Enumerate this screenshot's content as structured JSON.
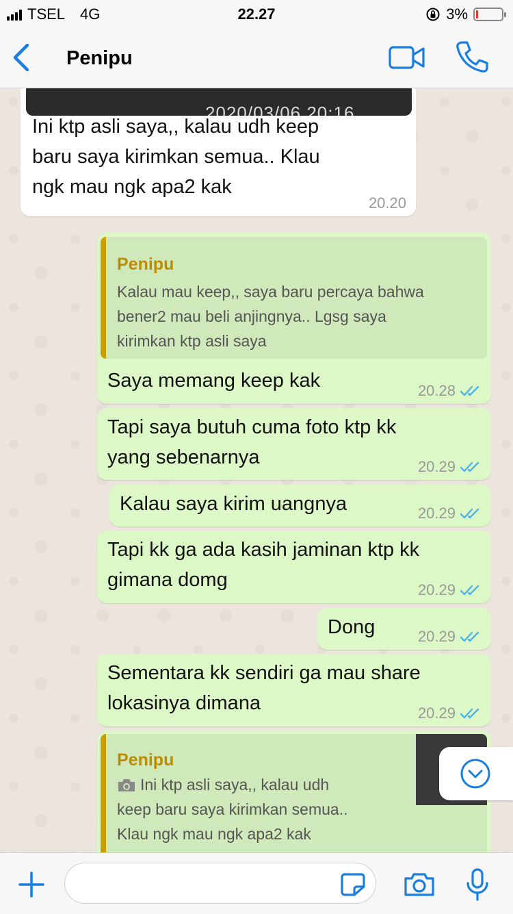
{
  "status": {
    "carrier": "TSEL",
    "network": "4G",
    "time": "22.27",
    "battery": "3%"
  },
  "header": {
    "contact": "Penipu"
  },
  "messages": [
    {
      "dir": "in",
      "image_stamp": "2020/03/06 20:16",
      "text": "Ini ktp asli saya,,  kalau udh keep\nbaru saya kirimkan semua..  Klau\nngk mau ngk apa2 kak",
      "time": "20.20"
    },
    {
      "dir": "out",
      "quote": {
        "name": "Penipu",
        "text": "Kalau mau keep,,  saya baru percaya bahwa\nbener2 mau beli anjingnya..  Lgsg saya\nkirimkan ktp asli saya"
      },
      "text": "Saya memang keep kak",
      "time": "20.28"
    },
    {
      "dir": "out",
      "text": "Tapi saya butuh cuma foto ktp kk\nyang sebenarnya",
      "time": "20.29"
    },
    {
      "dir": "out",
      "text": "Kalau saya kirim uangnya",
      "time": "20.29"
    },
    {
      "dir": "out",
      "text": "Tapi kk ga ada kasih jaminan ktp kk\ngimana domg",
      "time": "20.29"
    },
    {
      "dir": "out",
      "text": "Dong",
      "time": "20.29"
    },
    {
      "dir": "out",
      "text": "Sementara kk sendiri ga mau share\nlokasinya dimana",
      "time": "20.29"
    },
    {
      "dir": "out",
      "quote": {
        "name": "Penipu",
        "text": "Ini ktp asli saya,,  kalau udh\nkeep baru saya kirimkan semua..\nKlau ngk mau ngk apa2 kak"
      }
    }
  ],
  "colors": {
    "outgoing": "#dcf8c6",
    "incoming": "#ffffff",
    "accent": "#1a7ee0",
    "quote_name": "#bf8c00",
    "read_ticks": "#4fb3e8"
  },
  "icons": [
    "back-chevron-icon",
    "video-call-icon",
    "phone-icon",
    "double-check-icon",
    "camera-icon",
    "scroll-down-icon",
    "plus-icon",
    "sticker-icon",
    "microphone-icon"
  ]
}
